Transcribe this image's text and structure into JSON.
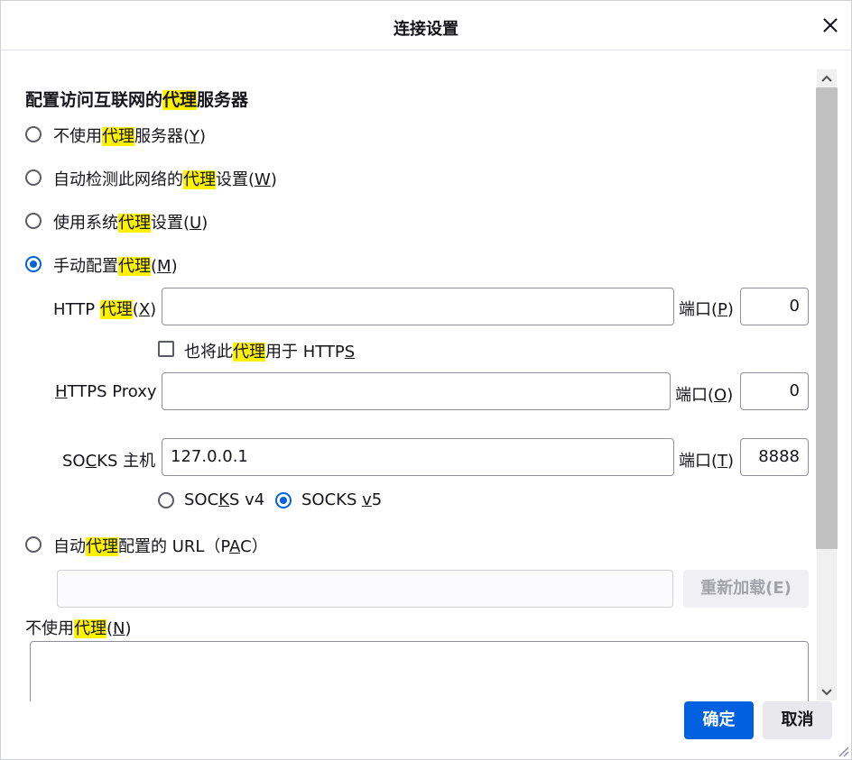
{
  "window": {
    "title": "连接设置"
  },
  "section_title": {
    "pre": "配置访问互联网的",
    "hl": "代理",
    "post": "服务器"
  },
  "radios": {
    "no_proxy": {
      "pre": "不使用",
      "hl": "代理",
      "post": "服务器(",
      "key": "Y",
      "end": ")"
    },
    "auto_detect": {
      "pre": "自动检测此网络的",
      "hl": "代理",
      "post": "设置(",
      "key": "W",
      "end": ")"
    },
    "system": {
      "pre": "使用系统",
      "hl": "代理",
      "post": "设置(",
      "key": "U",
      "end": ")"
    },
    "manual": {
      "pre": "手动配置",
      "hl": "代理",
      "post": "(",
      "key": "M",
      "end": ")"
    }
  },
  "http": {
    "label_pre": "HTTP ",
    "label_hl": "代理",
    "label_post": "(",
    "label_key": "X",
    "label_end": ")",
    "value": "",
    "port_pre": "端口(",
    "port_key": "P",
    "port_end": ")",
    "port": "0"
  },
  "also_https": {
    "pre": "也将此",
    "hl": "代理",
    "post": "用于 HTTP",
    "key": "S",
    "checked": false
  },
  "https": {
    "label_key": "H",
    "label_rest": "TTPS Proxy",
    "value": "",
    "port_pre": "端口(",
    "port_key": "O",
    "port_end": ")",
    "port": "0"
  },
  "socks": {
    "label_pre": "SO",
    "label_key": "C",
    "label_post": "KS 主机",
    "value": "127.0.0.1",
    "port_pre": "端口(",
    "port_key": "T",
    "port_end": ")",
    "port": "8888",
    "v4": {
      "pre": "SOC",
      "key": "K",
      "post": "S v4",
      "checked": false
    },
    "v5": {
      "pre": "SOCKS ",
      "key": "v",
      "post": "5",
      "checked": true
    }
  },
  "pac": {
    "pre": "自动",
    "hl": "代理",
    "post": "配置的 URL（P",
    "key": "A",
    "end": "C）",
    "value": "",
    "reload_label": "重新加载(E)"
  },
  "no_proxy_for": {
    "pre": "不使用",
    "hl": "代理",
    "post": "(",
    "key": "N",
    "end": ")",
    "value": ""
  },
  "footer": {
    "ok": "确定",
    "cancel": "取消"
  },
  "colors": {
    "accent": "#0061e0",
    "highlight": "#fff200"
  },
  "icons": [
    "close-icon",
    "scroll-up-icon",
    "scroll-down-icon",
    "resize-grip-icon"
  ]
}
